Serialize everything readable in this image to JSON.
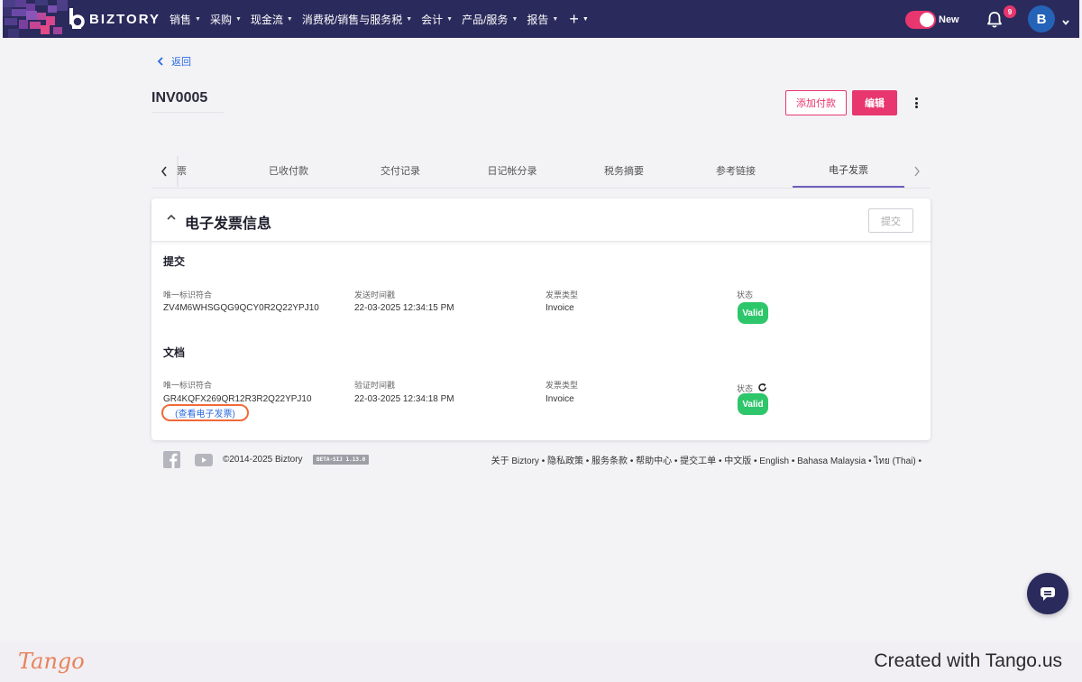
{
  "navbar": {
    "brand": "BIZTORY",
    "menu": [
      {
        "label": "销售"
      },
      {
        "label": "采购"
      },
      {
        "label": "现金流"
      },
      {
        "label": "消费税/销售与服务税"
      },
      {
        "label": "会计"
      },
      {
        "label": "产品/服务"
      },
      {
        "label": "报告"
      }
    ],
    "toggle_label": "New",
    "notification_count": "9",
    "avatar_initial": "B",
    "accent_color": "#e8366e",
    "bar_color": "#2b2a5c"
  },
  "header": {
    "back_label": "返回",
    "invoice_number": "INV0005",
    "add_payment_label": "添加付款",
    "edit_label": "编辑"
  },
  "tabs": {
    "items": [
      {
        "label": "票"
      },
      {
        "label": "已收付款"
      },
      {
        "label": "交付记录"
      },
      {
        "label": "日记帐分录"
      },
      {
        "label": "税务摘要"
      },
      {
        "label": "参考链接"
      },
      {
        "label": "电子发票"
      }
    ],
    "active": "电子发票"
  },
  "card": {
    "title": "电子发票信息",
    "submit_label": "提交",
    "submission": {
      "section_title": "提交",
      "uid_label": "唯一标识符合",
      "uid_value": "ZV4M6WHSGQG9QCY0R2Q22YPJ10",
      "time_label": "发送时间戳",
      "time_value": "22-03-2025 12:34:15 PM",
      "type_label": "发票类型",
      "type_value": "Invoice",
      "status_label": "状态",
      "status_value": "Valid"
    },
    "document": {
      "section_title": "文档",
      "uid_label": "唯一标识符合",
      "uid_value": "GR4KQFX269QR12R3R2Q22YPJ10",
      "view_link": "(查看电子发票)",
      "time_label": "验证时间戳",
      "time_value": "22-03-2025 12:34:18 PM",
      "type_label": "发票类型",
      "type_value": "Invoice",
      "status_label": "状态",
      "status_value": "Valid"
    },
    "status_color": "#2ec66a"
  },
  "footer": {
    "copyright": "©2014-2025 Biztory",
    "version_badge": "BETA-SIJ 1.13.0",
    "links": "关于 Biztory • 隐私政策 • 服务条款 • 帮助中心 • 提交工单 • 中文版 • English • Bahasa Malaysia • ไทย (Thai) •"
  },
  "tango": {
    "logo": "Tango",
    "credit": "Created with Tango.us"
  }
}
